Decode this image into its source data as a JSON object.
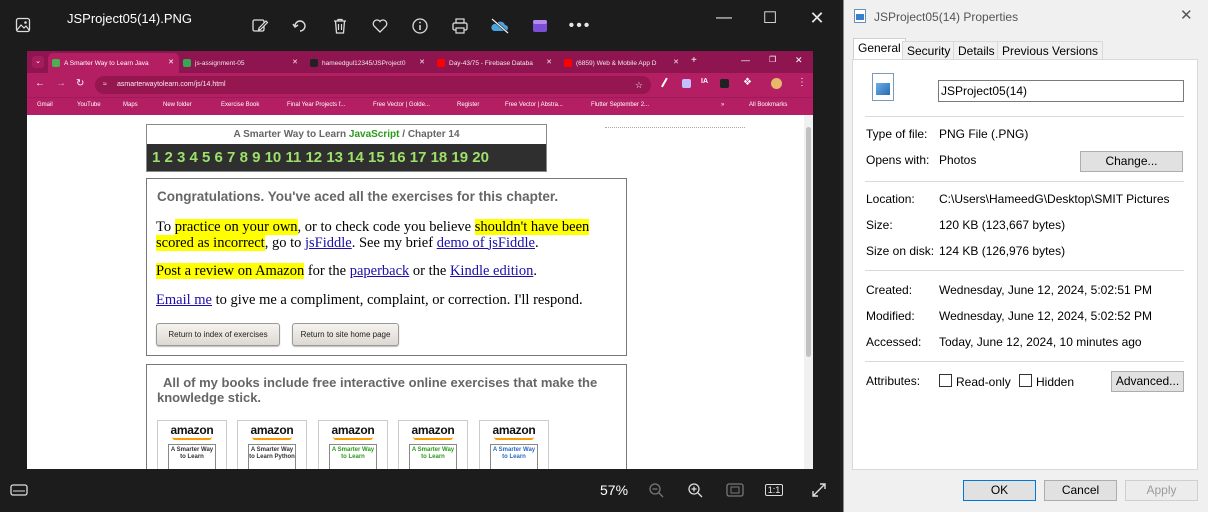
{
  "viewer": {
    "file_title": "JSProject05(14).PNG",
    "zoom": "57%",
    "toolbar_icons": [
      "gallery-icon",
      "edit-image-icon",
      "rotate-icon",
      "delete-icon",
      "favorite-icon",
      "info-icon",
      "print-icon",
      "onedrive-sync-icon",
      "clipchamp-icon",
      "more-icon"
    ],
    "window_controls": [
      "minimize",
      "maximize",
      "close"
    ]
  },
  "browser": {
    "tabs": [
      {
        "label": "A Smarter Way to Learn Java",
        "fav_color": "#4caf50",
        "active": true
      },
      {
        "label": "js-assignment-05",
        "fav_color": "#34a853",
        "active": false
      },
      {
        "label": "hameedgul12345/JSProject0",
        "fav_color": "#222222",
        "active": false
      },
      {
        "label": "Day-43/75 - Firebase Databa",
        "fav_color": "#ff0000",
        "active": false
      },
      {
        "label": "(6859) Web & Mobile App D",
        "fav_color": "#ff0000",
        "active": false
      }
    ],
    "new_tab": "+",
    "url": "asmarterwaytolearn.com/js/14.html",
    "bookmarks": [
      "Gmail",
      "YouTube",
      "Maps",
      "New folder",
      "Exercise Book",
      "Final Year Projects f...",
      "Free Vector | Golde...",
      "Register",
      "Free Vector | Abstra...",
      "Flutter September 2..."
    ],
    "all_bookmarks": "All Bookmarks"
  },
  "page": {
    "chapter_prefix": "A Smarter Way to Learn ",
    "chapter_js": "JavaScript",
    "chapter_suffix": " / Chapter 14",
    "chapter_numbers": "1 2 3 4 5 6 7 8 9 10 11 12 13 14 15 16 17 18 19 20",
    "congrats": "Congratulations. You've aced all the exercises for this chapter.",
    "p1": {
      "t1": "To ",
      "h1": "practice on your own",
      "t2": ", or to check code you believe ",
      "h2": "shouldn't have been scored as incorrect",
      "t3": ", go to ",
      "l1": "jsFiddle",
      "t4": ". See my brief ",
      "l2": "demo of jsFiddle",
      "t5": "."
    },
    "p2": {
      "h1": "Post a review on Amazon",
      "t1": " for the ",
      "l1": "paperback",
      "t2": " or the ",
      "l2": "Kindle edition",
      "t3": "."
    },
    "p3": {
      "l1": "Email me",
      "t1": " to give me a compliment, complaint, or correction. I'll respond."
    },
    "btn_index": "Return to index of exercises",
    "btn_home": "Return to site home page",
    "books_heading": "All of my books include free interactive online exercises that make the knowledge stick.",
    "book_brand": "amazon",
    "books": [
      {
        "cover": "A Smarter Way to Learn",
        "color": "#333333"
      },
      {
        "cover": "A Smarter Way to Learn Python",
        "color": "#333333"
      },
      {
        "cover": "A Smarter Way to Learn",
        "color": "#2a9a1a"
      },
      {
        "cover": "A Smarter Way to Learn",
        "color": "#2a9a1a"
      },
      {
        "cover": "A Smarter Way to Learn",
        "color": "#2a6ac0"
      }
    ]
  },
  "dialog": {
    "title": "JSProject05(14) Properties",
    "tabs": [
      "General",
      "Security",
      "Details",
      "Previous Versions"
    ],
    "filename": "JSProject05(14)",
    "rows": {
      "type_label": "Type of file:",
      "type_value": "PNG File (.PNG)",
      "opens_label": "Opens with:",
      "opens_value": "Photos",
      "change_btn": "Change...",
      "location_label": "Location:",
      "location_value": "C:\\Users\\HameedG\\Desktop\\SMIT Pictures",
      "size_label": "Size:",
      "size_value": "120 KB (123,667 bytes)",
      "disk_label": "Size on disk:",
      "disk_value": "124 KB (126,976 bytes)",
      "created_label": "Created:",
      "created_value": "Wednesday, June 12, 2024, 5:02:51 PM",
      "modified_label": "Modified:",
      "modified_value": "Wednesday, June 12, 2024, 5:02:52 PM",
      "accessed_label": "Accessed:",
      "accessed_value": "Today, June 12, 2024, 10 minutes ago",
      "attributes_label": "Attributes:",
      "readonly": "Read-only",
      "hidden": "Hidden",
      "advanced_btn": "Advanced..."
    },
    "ok": "OK",
    "cancel": "Cancel",
    "apply": "Apply"
  }
}
